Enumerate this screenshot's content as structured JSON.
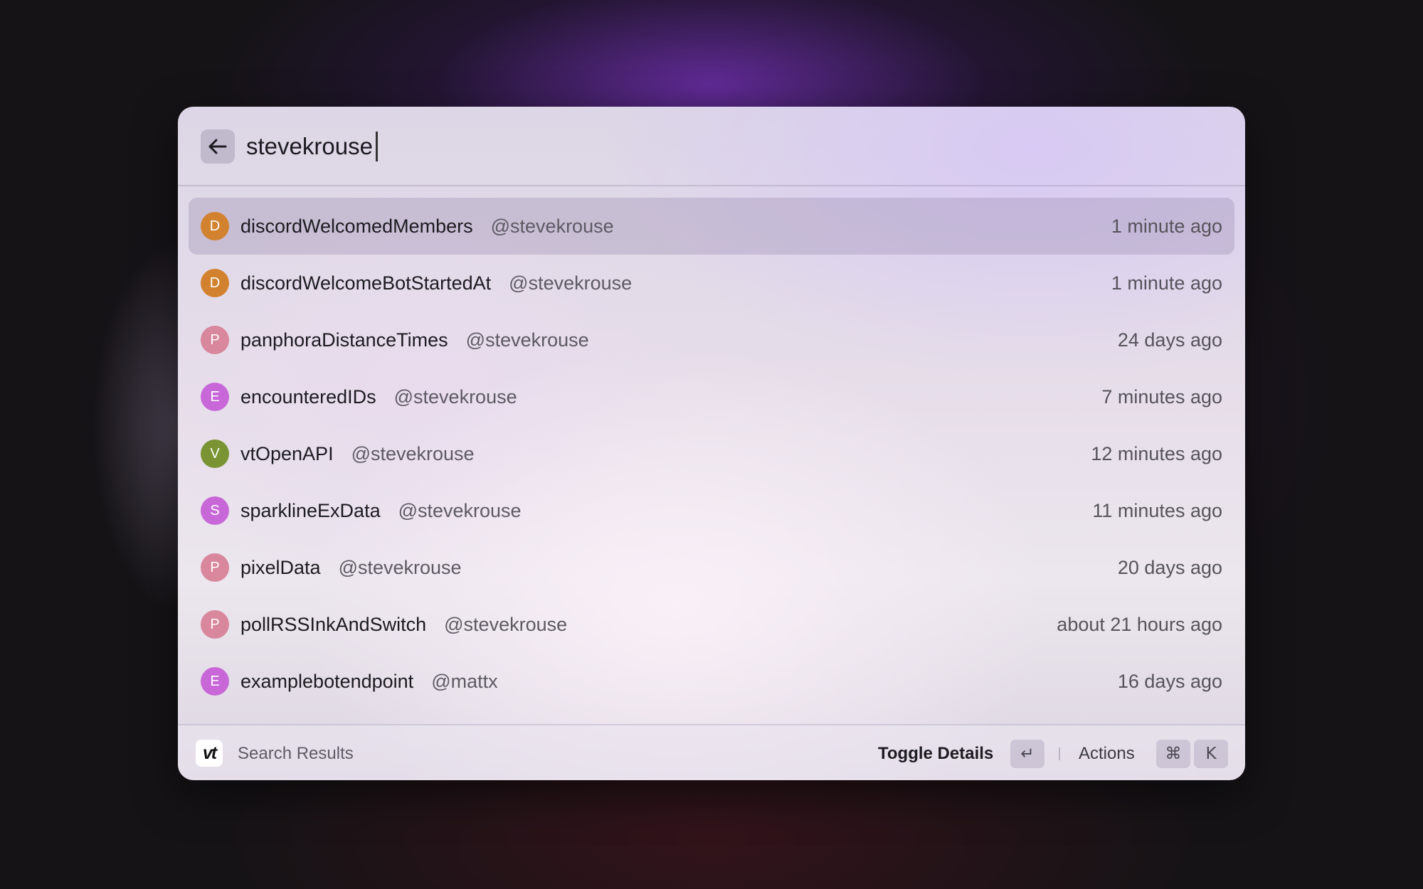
{
  "search": {
    "value": "stevekrouse",
    "back_icon": "arrow-left-icon"
  },
  "results": [
    {
      "initial": "D",
      "avatar_color": "#d2822e",
      "name": "discordWelcomedMembers",
      "author": "@stevekrouse",
      "time": "1 minute ago",
      "selected": true
    },
    {
      "initial": "D",
      "avatar_color": "#d2822e",
      "name": "discordWelcomeBotStartedAt",
      "author": "@stevekrouse",
      "time": "1 minute ago",
      "selected": false
    },
    {
      "initial": "P",
      "avatar_color": "#d9879c",
      "name": "panphoraDistanceTimes",
      "author": "@stevekrouse",
      "time": "24 days ago",
      "selected": false
    },
    {
      "initial": "E",
      "avatar_color": "#c868d8",
      "name": "encounteredIDs",
      "author": "@stevekrouse",
      "time": "7 minutes ago",
      "selected": false
    },
    {
      "initial": "V",
      "avatar_color": "#7a9434",
      "name": "vtOpenAPI",
      "author": "@stevekrouse",
      "time": "12 minutes ago",
      "selected": false
    },
    {
      "initial": "S",
      "avatar_color": "#c868d8",
      "name": "sparklineExData",
      "author": "@stevekrouse",
      "time": "11 minutes ago",
      "selected": false
    },
    {
      "initial": "P",
      "avatar_color": "#d9879c",
      "name": "pixelData",
      "author": "@stevekrouse",
      "time": "20 days ago",
      "selected": false
    },
    {
      "initial": "P",
      "avatar_color": "#d9879c",
      "name": "pollRSSInkAndSwitch",
      "author": "@stevekrouse",
      "time": "about 21 hours ago",
      "selected": false
    },
    {
      "initial": "E",
      "avatar_color": "#c868d8",
      "name": "examplebotendpoint",
      "author": "@mattx",
      "time": "16 days ago",
      "selected": false
    }
  ],
  "footer": {
    "logo_text": "vt",
    "title": "Search Results",
    "toggle_details_label": "Toggle Details",
    "toggle_details_key": "↵",
    "actions_label": "Actions",
    "actions_key_1": "⌘",
    "actions_key_2": "K"
  }
}
